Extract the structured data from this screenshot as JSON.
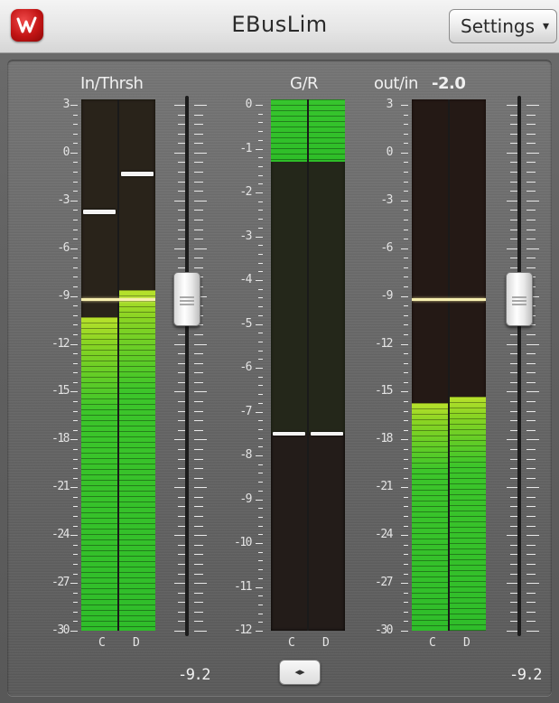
{
  "window": {
    "title": "EBusLim",
    "settings_label": "Settings",
    "settings_arrow": "▾",
    "logo_icon": "waves-logo-icon"
  },
  "input_section": {
    "header": "In/Thrsh",
    "scale": [
      "3",
      "0",
      "-3",
      "-6",
      "-9",
      "-12",
      "-15",
      "-18",
      "-21",
      "-24",
      "-27",
      "-30"
    ],
    "channels": [
      {
        "label": "C",
        "level_db": -10.3,
        "peak_db": -3.7
      },
      {
        "label": "D",
        "level_db": -8.6,
        "peak_db": -1.3
      }
    ],
    "threshold_db": -9.2,
    "threshold_readout": "-9.2"
  },
  "gr_section": {
    "header": "G/R",
    "scale": [
      "0",
      "-1",
      "-2",
      "-3",
      "-4",
      "-5",
      "-6",
      "-7",
      "-8",
      "-9",
      "-10",
      "-11",
      "-12"
    ],
    "channels": [
      {
        "label": "C",
        "reduction_db": 1.3,
        "peak_db": 7.5
      },
      {
        "label": "D",
        "reduction_db": 1.3,
        "peak_db": 7.5
      }
    ],
    "link_label": "◂▸"
  },
  "output_section": {
    "header": "out/in",
    "header_value": "-2.0",
    "scale": [
      "3",
      "0",
      "-3",
      "-6",
      "-9",
      "-12",
      "-15",
      "-18",
      "-21",
      "-24",
      "-27",
      "-30"
    ],
    "channels": [
      {
        "label": "C",
        "level_db": -15.7
      },
      {
        "label": "D",
        "level_db": -15.3
      }
    ],
    "ceiling_db": -9.2,
    "ceiling_readout": "-9.2"
  },
  "colors": {
    "meter_green": "#2fbd2a",
    "meter_yellow": "#b9e12c",
    "threshold": "#f7efb0",
    "meter_bg": "#231c19"
  }
}
